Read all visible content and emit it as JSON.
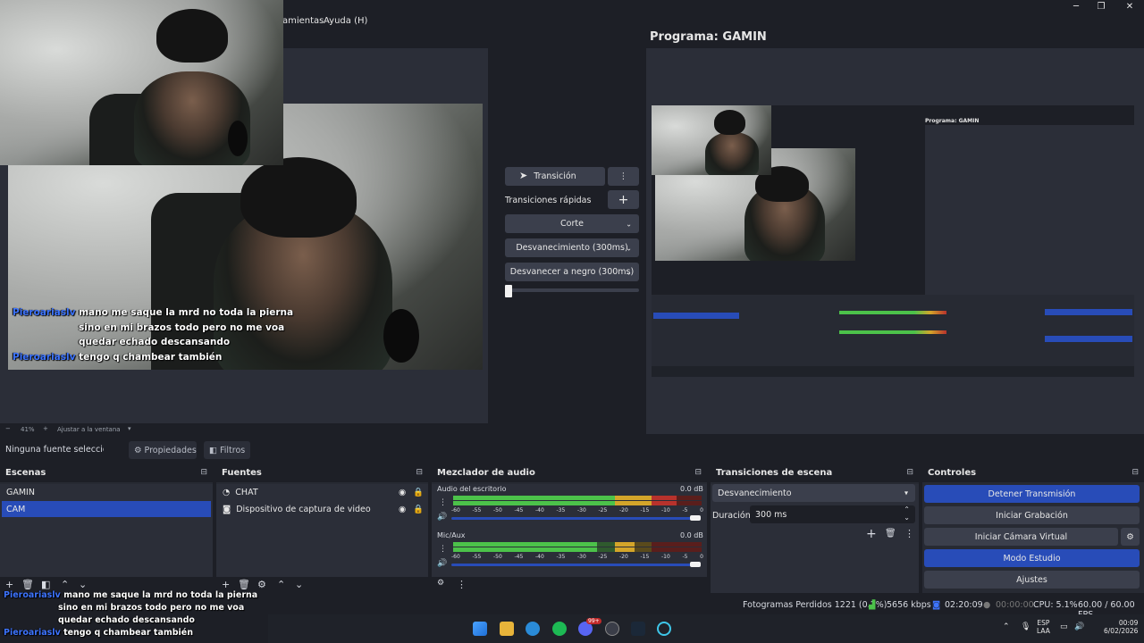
{
  "menu": {
    "partial_item": "amientas",
    "help": "Ayuda (H)"
  },
  "window_controls": {
    "minimize": "─",
    "maximize": "❐",
    "close": "✕"
  },
  "preview": {
    "chat": [
      {
        "user": "Pieroariaslv",
        "text": "mano me saque la mrd no toda la pierna"
      },
      {
        "user": "",
        "text": "sino en mi brazos todo pero no me voa"
      },
      {
        "user": "",
        "text": "quedar echado descansando"
      },
      {
        "user": "Pieroariaslv",
        "text": "tengo q chambear también"
      }
    ],
    "zoom": {
      "minus": "−",
      "percent": "41%",
      "plus": "+",
      "fit_label": "Ajustar a la ventana"
    }
  },
  "transition_panel": {
    "transition_button": "Transición",
    "more_icon": "⋮",
    "quick_label": "Transiciones rápidas",
    "add_icon": "+",
    "options": [
      "Corte",
      "Desvanecimiento (300ms)",
      "Desvanecer a negro (300ms)"
    ]
  },
  "program": {
    "title": "Programa: GAMIN",
    "nested_title": "Programa: GAMIN"
  },
  "props_bar": {
    "no_source": "Ninguna fuente seleccionada",
    "properties": "Propiedades",
    "filters": "Filtros"
  },
  "scenes": {
    "title": "Escenas",
    "items": [
      "GAMIN",
      "CAM"
    ],
    "selected": "CAM"
  },
  "sources": {
    "title": "Fuentes",
    "items": [
      "CHAT",
      "Dispositivo de captura de video"
    ]
  },
  "mixer": {
    "title": "Mezclador de audio",
    "tracks": [
      {
        "name": "Audio del escritorio",
        "db": "0.0 dB",
        "level": 0.9
      },
      {
        "name": "Mic/Aux",
        "db": "0.0 dB",
        "level": 0.65
      }
    ],
    "scale": [
      "-60",
      "-55",
      "-50",
      "-45",
      "-40",
      "-35",
      "-30",
      "-25",
      "-20",
      "-15",
      "-10",
      "-5",
      "0"
    ]
  },
  "scene_transitions": {
    "title": "Transiciones de escena",
    "selected": "Desvanecimiento",
    "duration_label": "Duración",
    "duration_value": "300 ms"
  },
  "controls": {
    "title": "Controles",
    "buttons": [
      "Detener Transmisión",
      "Iniciar Grabación",
      "Iniciar Cámara Virtual",
      "Modo Estudio",
      "Ajustes"
    ]
  },
  "overlay_chat": [
    {
      "user": "Pieroariaslv",
      "text": "mano me saque la mrd no toda la pierna"
    },
    {
      "user": "",
      "text": "sino en mi brazos todo pero no me voa"
    },
    {
      "user": "",
      "text": "quedar echado descansando"
    },
    {
      "user": "Pieroariaslv",
      "text": "tengo q chambear también"
    }
  ],
  "status": {
    "dropped_frames": "Fotogramas Perdidos 1221 (0.2%)",
    "bitrate": "5656 kbps",
    "stream_time": "02:20:09",
    "rec_time": "00:00:00",
    "cpu": "CPU: 5.1%",
    "fps": "60.00 / 60.00 FPS"
  },
  "tray": {
    "lang1": "ESP",
    "lang2": "LAA",
    "time": "00:09",
    "date": "6/02/2026",
    "badge": "99+"
  },
  "colors": {
    "accent": "#284cb8",
    "meter_green": "#4cc24a",
    "meter_yellow": "#d4a52a",
    "meter_red": "#b8322c"
  }
}
